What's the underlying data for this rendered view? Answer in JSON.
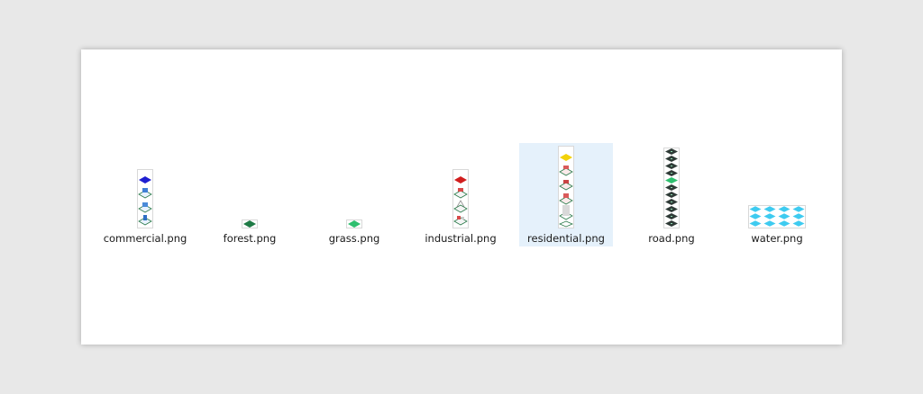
{
  "files": [
    {
      "name": "commercial.png",
      "selected": false,
      "icon": "commercial-sprite-thumbnail"
    },
    {
      "name": "forest.png",
      "selected": false,
      "icon": "forest-tile-thumbnail"
    },
    {
      "name": "grass.png",
      "selected": false,
      "icon": "grass-tile-thumbnail"
    },
    {
      "name": "industrial.png",
      "selected": false,
      "icon": "industrial-sprite-thumbnail"
    },
    {
      "name": "residential.png",
      "selected": true,
      "icon": "residential-sprite-thumbnail"
    },
    {
      "name": "road.png",
      "selected": false,
      "icon": "road-sprite-thumbnail"
    },
    {
      "name": "water.png",
      "selected": false,
      "icon": "water-sprite-thumbnail"
    }
  ],
  "colors": {
    "selection_bg": "#e5f1fb",
    "commercial": "#1f1fd1",
    "forest": "#1e7a45",
    "grass": "#2fbf6f",
    "industrial": "#d11d1d",
    "residential": "#f2d20a",
    "road": "#2f3b37",
    "water": "#3ecbf0"
  }
}
